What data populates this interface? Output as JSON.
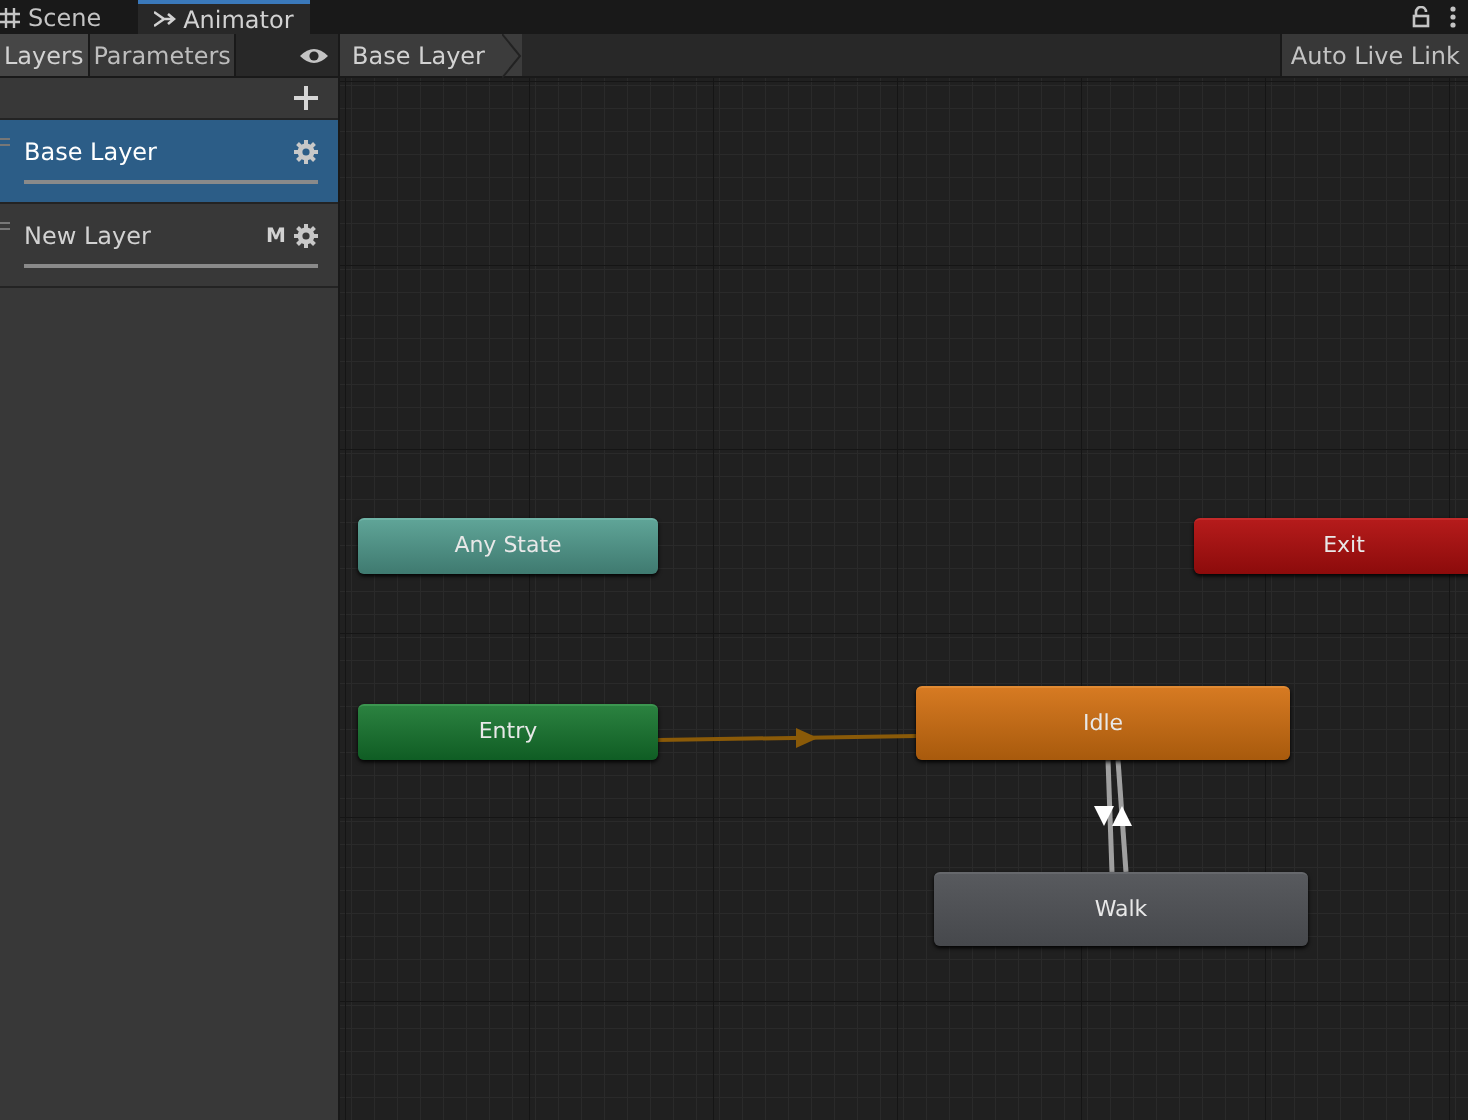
{
  "window_tabs": [
    {
      "label": "Scene",
      "kind": "grid",
      "selected": false
    },
    {
      "label": "Animator",
      "kind": "animator",
      "selected": true
    }
  ],
  "panel_tabs": [
    {
      "label": "Layers",
      "selected": true
    },
    {
      "label": "Parameters",
      "selected": false
    }
  ],
  "breadcrumb": "Base Layer",
  "auto_live_link": {
    "label": "Auto Live Link",
    "on": false
  },
  "layers": [
    {
      "name": "Base Layer",
      "selected": true
    },
    {
      "name": "New Layer",
      "selected": false,
      "badge": "M"
    }
  ],
  "states": [
    {
      "name": "Any State",
      "kind": "any"
    },
    {
      "name": "Entry",
      "kind": "entry"
    },
    {
      "name": "Exit",
      "kind": "exit"
    },
    {
      "name": "Idle",
      "kind": "default"
    },
    {
      "name": "Walk",
      "kind": "normal"
    }
  ]
}
